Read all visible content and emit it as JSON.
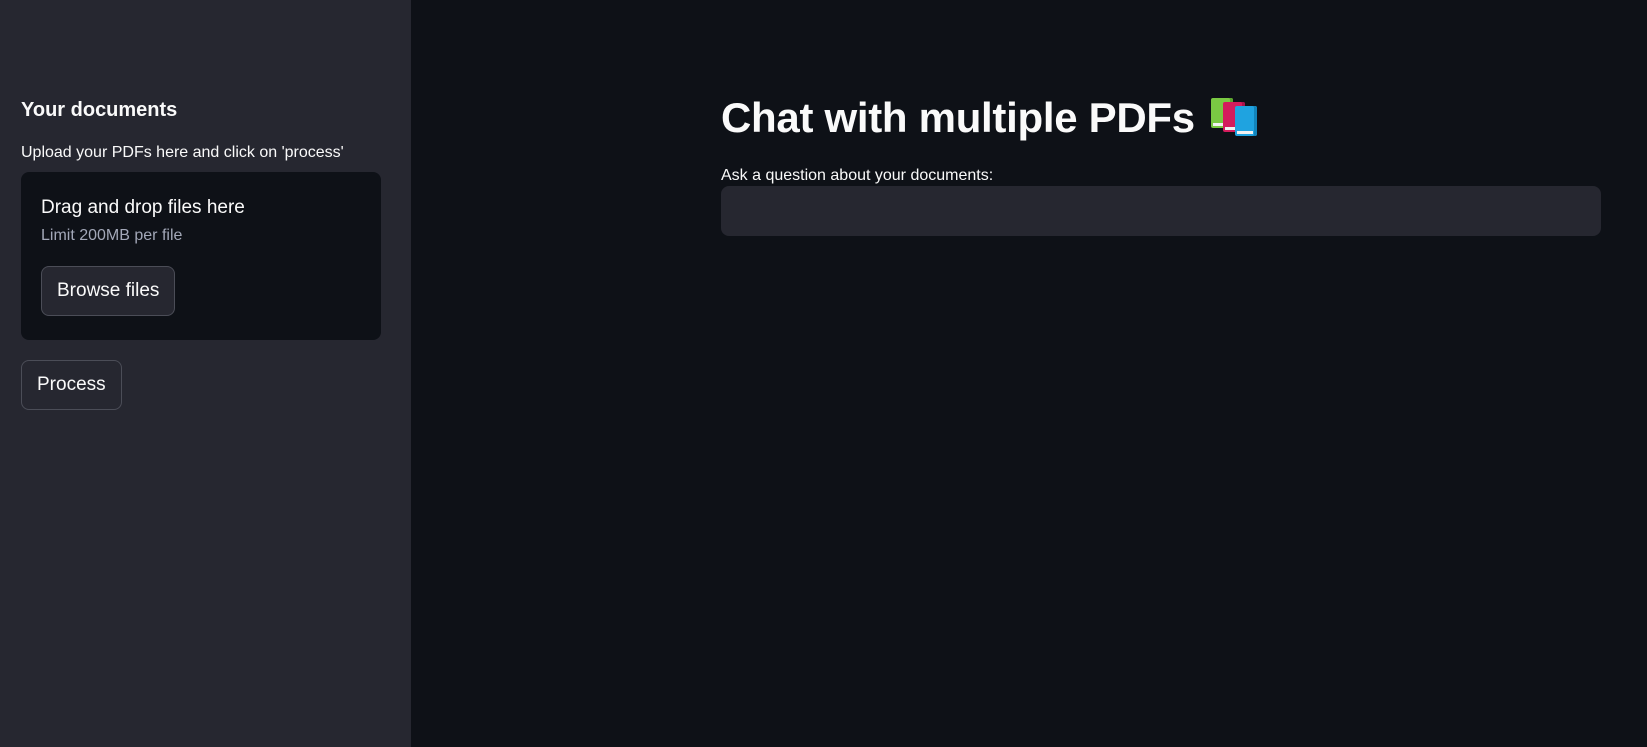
{
  "sidebar": {
    "heading": "Your documents",
    "upload_label": "Upload your PDFs here and click on 'process'",
    "dropzone": {
      "title": "Drag and drop files here",
      "limit": "Limit 200MB per file",
      "browse_label": "Browse files"
    },
    "process_label": "Process"
  },
  "main": {
    "title": "Chat with multiple PDFs",
    "title_icon": "books-icon",
    "question_label": "Ask a question about your documents:",
    "question_value": "",
    "question_placeholder": ""
  },
  "colors": {
    "sidebar_bg": "#262730",
    "main_bg": "#0e1117",
    "text": "#fafafa",
    "muted_text": "#a3a8b8"
  }
}
